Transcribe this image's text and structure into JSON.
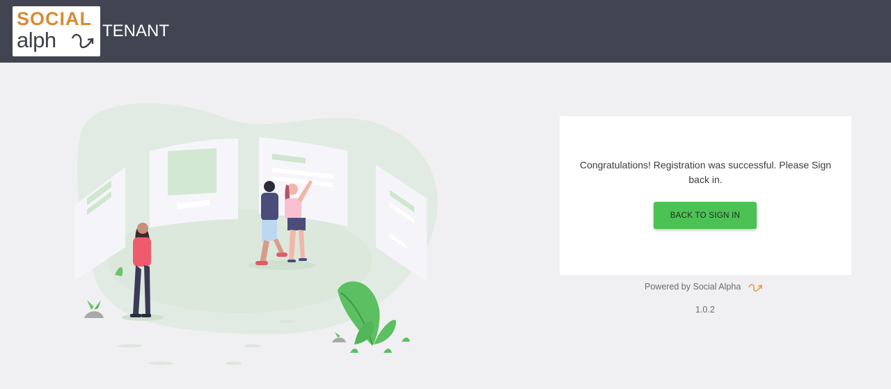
{
  "header": {
    "logo": {
      "line1": "SOCIAL",
      "line2": "alph",
      "brand_color": "#d98b34",
      "text_color": "#3d3f46"
    },
    "title": "TENANT",
    "background": "#424551"
  },
  "card": {
    "message": "Congratulations! Registration was successful. Please Sign back in.",
    "button_label": "BACK TO SIGN IN",
    "button_color": "#4cc255"
  },
  "footer": {
    "powered_by": "Powered by Social Alpha",
    "brand_icon": "alpha-arrow-icon",
    "version": "1.0.2"
  },
  "illustration": {
    "name": "people-viewing-gallery-illustration"
  }
}
